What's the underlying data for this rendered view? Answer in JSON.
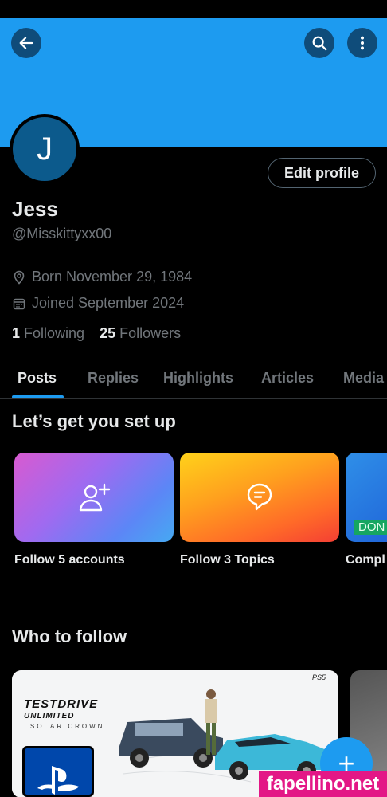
{
  "profile": {
    "avatar_initial": "J",
    "name": "Jess",
    "handle": "@Misskittyxx00",
    "born": "Born November 29, 1984",
    "joined": "Joined September 2024",
    "following_count": "1",
    "following_label": "Following",
    "followers_count": "25",
    "followers_label": "Followers",
    "edit_label": "Edit profile"
  },
  "tabs": [
    {
      "label": "Posts",
      "active": true
    },
    {
      "label": "Replies"
    },
    {
      "label": "Highlights"
    },
    {
      "label": "Articles"
    },
    {
      "label": "Media"
    }
  ],
  "setup": {
    "title": "Let’s get you set up",
    "cards": [
      {
        "label": "Follow 5 accounts",
        "icon": "add-user-icon"
      },
      {
        "label": "Follow 3 Topics",
        "icon": "topic-bubble-icon"
      },
      {
        "label": "Compl",
        "badge": "DON"
      }
    ]
  },
  "who_to_follow": {
    "title": "Who to follow",
    "promo_brand": "TESTDRIVE",
    "promo_sub": "UNLIMITED",
    "promo_sub2": "SOLAR CROWN",
    "promo_platform": "PS5"
  },
  "fab": {
    "label": "+"
  },
  "watermark": "fapellino.net",
  "colors": {
    "accent": "#1d9bf0",
    "banner": "#1d9bf0",
    "background": "#000000"
  }
}
